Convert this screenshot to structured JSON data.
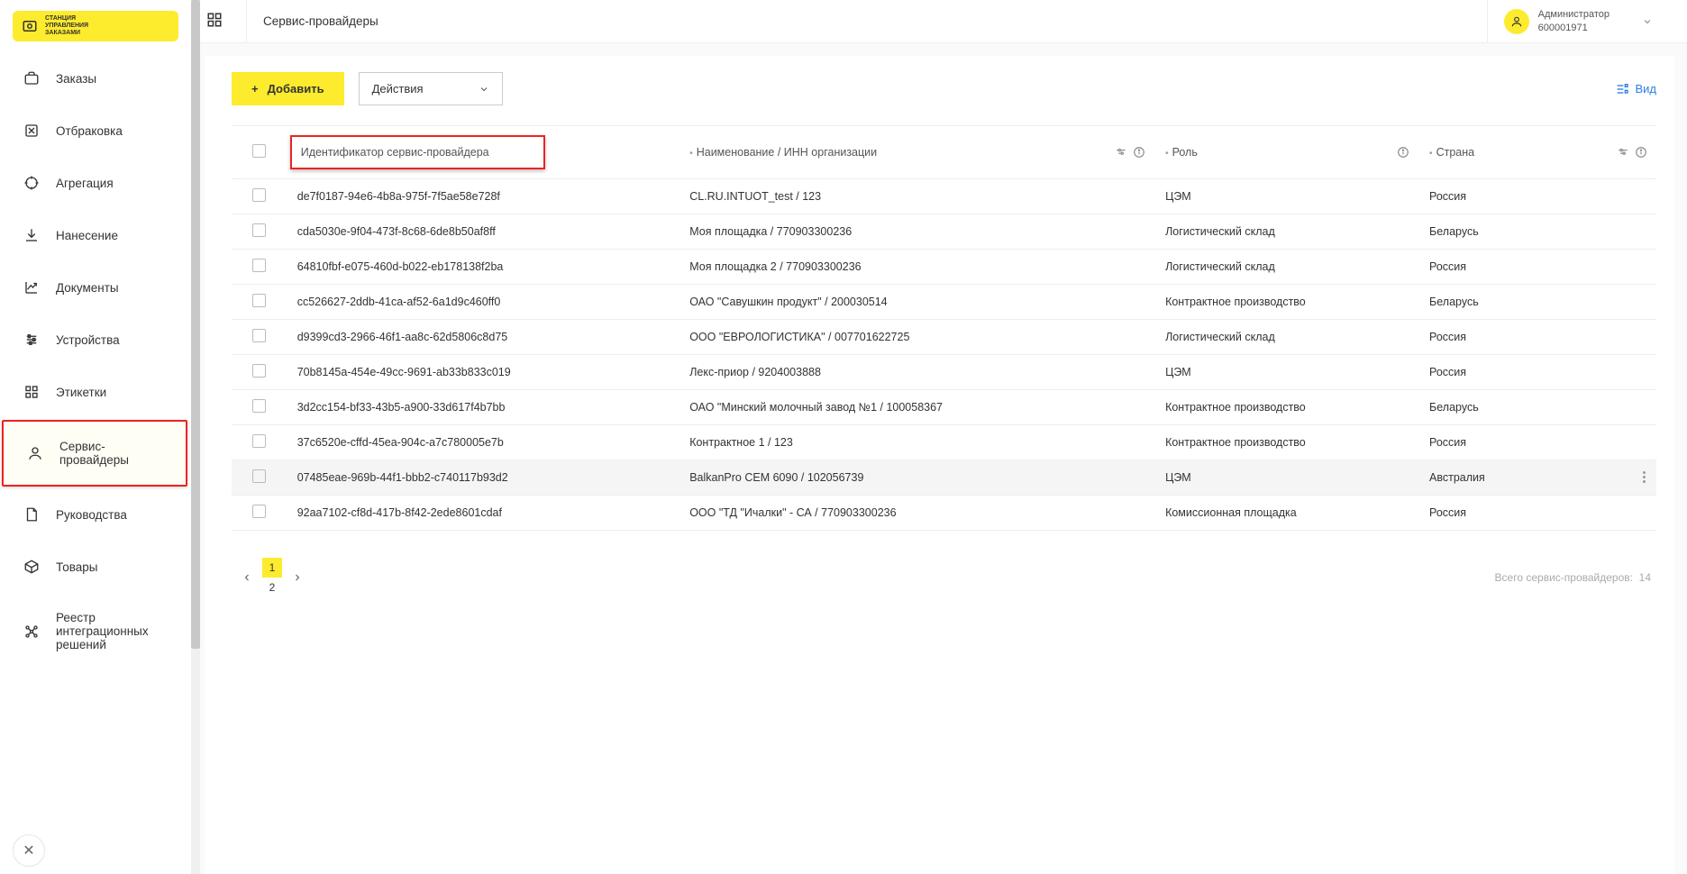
{
  "logo_text": "СТАНЦИЯ\nУПРАВЛЕНИЯ\nЗАКАЗАМИ",
  "sidebar": {
    "items": [
      {
        "label": "Заказы",
        "icon": "briefcase-icon"
      },
      {
        "label": "Отбраковка",
        "icon": "reject-icon"
      },
      {
        "label": "Агрегация",
        "icon": "target-icon"
      },
      {
        "label": "Нанесение",
        "icon": "download-icon"
      },
      {
        "label": "Документы",
        "icon": "chart-icon"
      },
      {
        "label": "Устройства",
        "icon": "sliders-icon"
      },
      {
        "label": "Этикетки",
        "icon": "apps-icon"
      },
      {
        "label": "Сервис-провайдеры",
        "icon": "user-icon",
        "active": true
      },
      {
        "label": "Руководства",
        "icon": "file-icon"
      },
      {
        "label": "Товары",
        "icon": "box-icon"
      },
      {
        "label": "Реестр интеграционных решений",
        "icon": "network-icon"
      }
    ]
  },
  "header": {
    "title": "Сервис-провайдеры",
    "user_role": "Администратор",
    "user_id": "600001971"
  },
  "toolbar": {
    "add_label": "Добавить",
    "actions_label": "Действия",
    "view_label": "Вид"
  },
  "table": {
    "columns": {
      "id": "Идентификатор сервис-провайдера",
      "name": "Наименование / ИНН организации",
      "role": "Роль",
      "country": "Страна"
    },
    "rows": [
      {
        "id": "de7f0187-94e6-4b8a-975f-7f5ae58e728f",
        "name": "CL.RU.INTUOT_test / 123",
        "role": "ЦЭМ",
        "country": "Россия"
      },
      {
        "id": "cda5030e-9f04-473f-8c68-6de8b50af8ff",
        "name": "Моя площадка / 770903300236",
        "role": "Логистический склад",
        "country": "Беларусь"
      },
      {
        "id": "64810fbf-e075-460d-b022-eb178138f2ba",
        "name": "Моя площадка 2 / 770903300236",
        "role": "Логистический склад",
        "country": "Россия"
      },
      {
        "id": "cc526627-2ddb-41ca-af52-6a1d9c460ff0",
        "name": "ОАО \"Савушкин продукт\" / 200030514",
        "role": "Контрактное производство",
        "country": "Беларусь"
      },
      {
        "id": "d9399cd3-2966-46f1-aa8c-62d5806c8d75",
        "name": "ООО \"ЕВРОЛОГИСТИКА\" / 007701622725",
        "role": "Логистический склад",
        "country": "Россия"
      },
      {
        "id": "70b8145a-454e-49cc-9691-ab33b833c019",
        "name": "Лекс-приор / 9204003888",
        "role": "ЦЭМ",
        "country": "Россия"
      },
      {
        "id": "3d2cc154-bf33-43b5-a900-33d617f4b7bb",
        "name": "ОАО \"Минский молочный завод №1 / 100058367",
        "role": "Контрактное производство",
        "country": "Беларусь"
      },
      {
        "id": "37c6520e-cffd-45ea-904c-a7c780005e7b",
        "name": "Контрактное 1 / 123",
        "role": "Контрактное производство",
        "country": "Россия"
      },
      {
        "id": "07485eae-969b-44f1-bbb2-c740117b93d2",
        "name": "BalkanPro CEM 6090 / 102056739",
        "role": "ЦЭМ",
        "country": "Австралия",
        "hovered": true
      },
      {
        "id": "92aa7102-cf8d-417b-8f42-2ede8601cdaf",
        "name": "ООО \"ТД \"Ичалки\" - СА / 770903300236",
        "role": "Комиссионная площадка",
        "country": "Россия"
      }
    ]
  },
  "pagination": {
    "current": 1,
    "pages": [
      1,
      2
    ],
    "total_label": "Всего сервис-провайдеров:",
    "total_count": 14
  }
}
